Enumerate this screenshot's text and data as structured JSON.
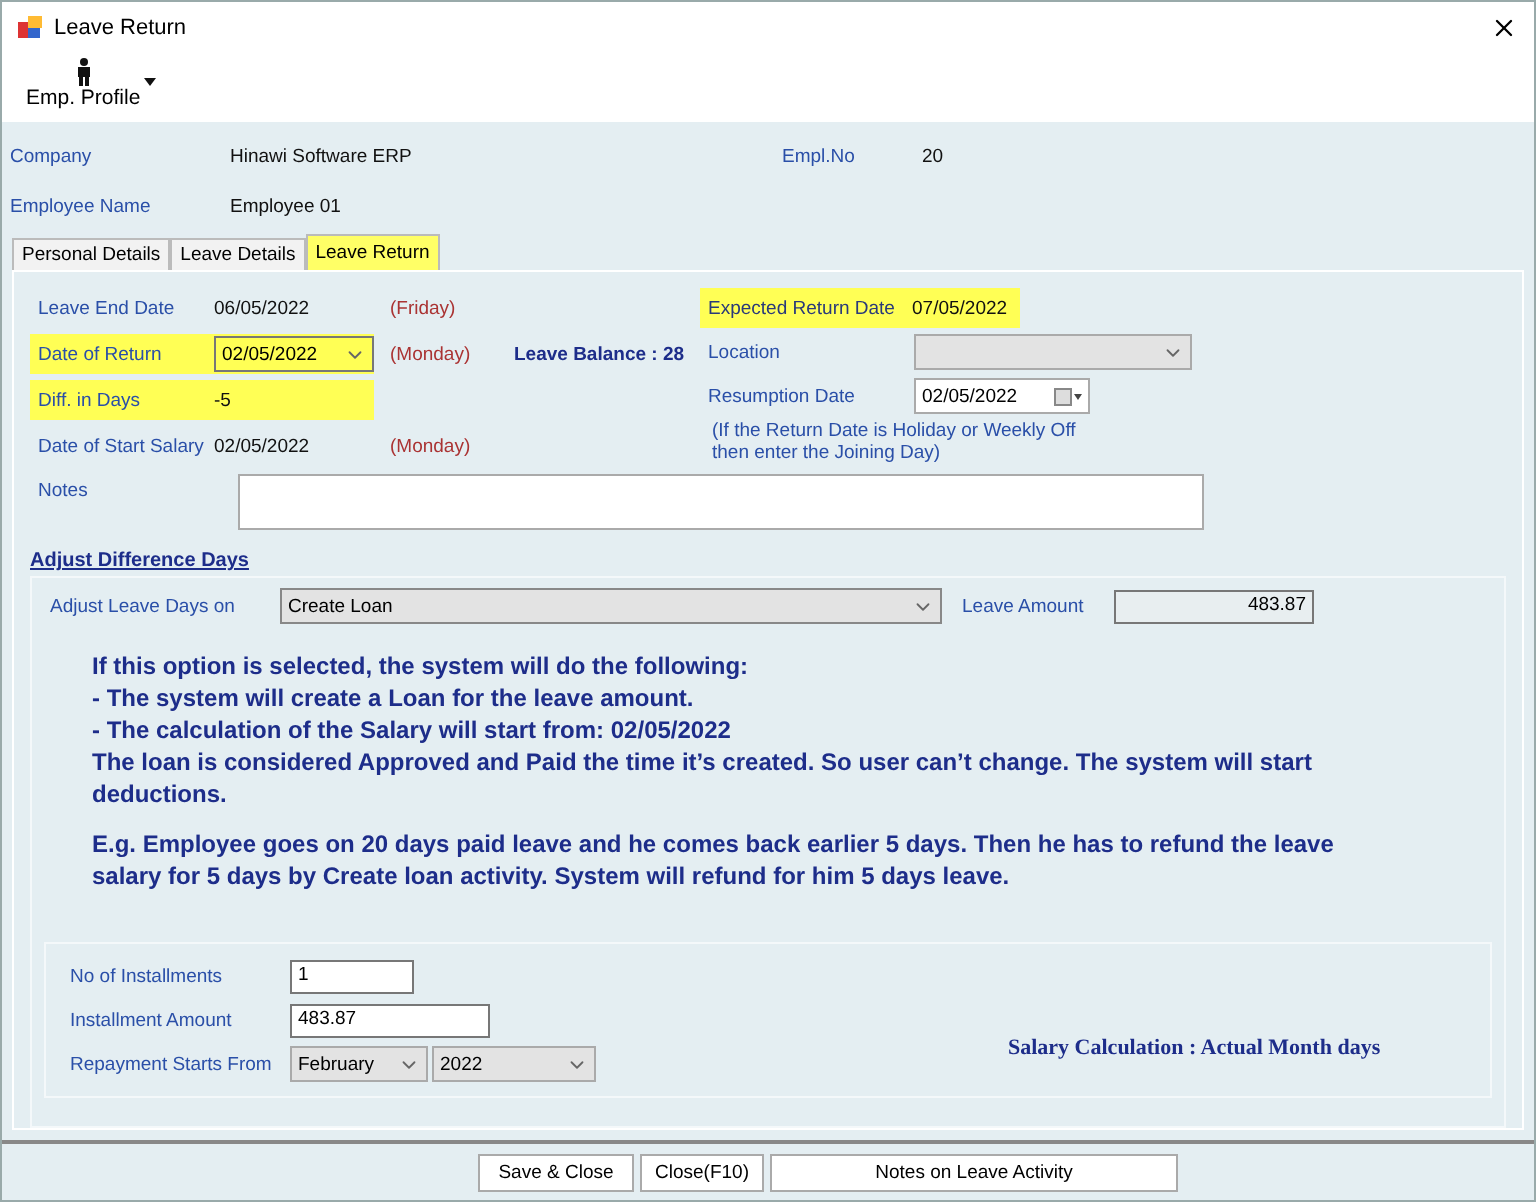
{
  "window": {
    "title": "Leave Return"
  },
  "toolbar": {
    "button": "Emp. Profile"
  },
  "header": {
    "company_label": "Company",
    "company": "Hinawi Software ERP",
    "empl_no_label": "Empl.No",
    "empl_no": "20",
    "employee_label": "Employee Name",
    "employee": "Employee 01"
  },
  "tabs": [
    {
      "label": "Personal Details",
      "selected": false
    },
    {
      "label": "Leave Details",
      "selected": false
    },
    {
      "label": "Leave Return",
      "selected": true
    }
  ],
  "left_fields": [
    {
      "kind": "text",
      "label": "Leave End Date",
      "value": "06/05/2022",
      "day": "(Friday)",
      "highlighted": false
    },
    {
      "kind": "combo",
      "label": "Date of Return",
      "value": "02/05/2022",
      "day": "(Monday)",
      "highlighted": true
    },
    {
      "kind": "text",
      "label": "Diff. in Days",
      "value": "-5",
      "highlighted": true
    },
    {
      "kind": "text",
      "label": "Date of Start Salary",
      "value": "02/05/2022",
      "day": "(Monday)",
      "highlighted": false
    }
  ],
  "leave_balance": "Leave Balance : 28",
  "expected_return": {
    "label": "Expected Return Date",
    "value": "07/05/2022",
    "highlighted": true
  },
  "location": {
    "label": "Location",
    "disabled": true
  },
  "resumption": {
    "label": "Resumption Date",
    "value": "02/05/2022",
    "hint": "(If the Return Date is Holiday or Weekly Off\nthen enter the Joining Day)"
  },
  "notes": {
    "label": "Notes"
  },
  "adjust": {
    "title": "Adjust Difference Days",
    "label": "Adjust Leave Days on",
    "value": "Create Loan",
    "amount_label": "Leave Amount",
    "amount": "483.87"
  },
  "explanation": [
    [
      "If this option is selected, the system will do the following:",
      "- The system will create a Loan for the leave amount.",
      "- The calculation of the Salary will start from: 02/05/2022",
      "The loan is considered Approved and Paid the time it’s created. So user can’t change. The system will start deductions."
    ],
    [
      "E.g. Employee goes on 20 days paid leave and he comes back earlier 5 days. Then he has to refund the leave salary for 5 days by Create loan activity. System will refund for him 5 days leave."
    ]
  ],
  "installments": {
    "count_label": "No of Installments",
    "count": "1",
    "amount_label": "Installment Amount",
    "amount": "483.87",
    "repay_label": "Repayment Starts From",
    "month": "February",
    "year": "2022",
    "salary_calc": "Salary Calculation : Actual Month days"
  },
  "buttons": [
    "Save & Close",
    "Close(F10)",
    "Notes on Leave Activity"
  ]
}
